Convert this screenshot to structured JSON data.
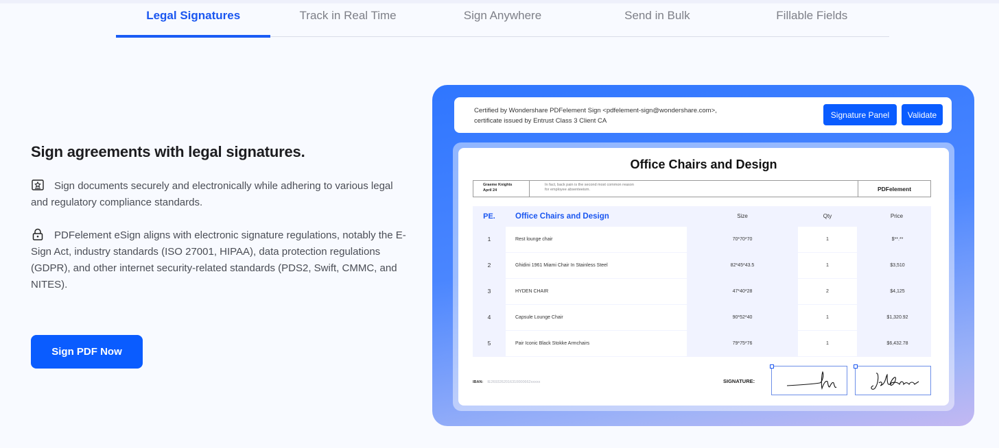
{
  "tabs": [
    {
      "label": "Legal Signatures",
      "active": true
    },
    {
      "label": "Track in Real Time",
      "active": false
    },
    {
      "label": "Sign Anywhere",
      "active": false
    },
    {
      "label": "Send in Bulk",
      "active": false
    },
    {
      "label": "Fillable Fields",
      "active": false
    }
  ],
  "content": {
    "heading": "Sign agreements with legal signatures.",
    "para1": "Sign documents securely and electronically while adhering to various legal and regulatory compliance standards.",
    "para2": "PDFelement eSign aligns with electronic signature regulations, notably the E-Sign Act, industry standards (ISO 27001, HIPAA), data protection regulations (GDPR), and other internet security-related standards (PDS2, Swift, CMMC, and NITES).",
    "para1_icon": "certificate-icon",
    "para2_icon": "lock-icon",
    "cta_label": "Sign PDF Now"
  },
  "preview": {
    "cert_line1": "Certified by Wondershare PDFelement Sign <pdfelement-sign@wondershare.com>,",
    "cert_line2": "certificate issued by Entrust Class 3 Client CA",
    "signature_panel_label": "Signature Panel",
    "validate_label": "Validate",
    "doc_title": "Office Chairs and Design",
    "info_name": "Graeme Knights",
    "info_date": "April 24",
    "info_text1": "In fact, back pain is the second most common reason",
    "info_text2": "for employee absenteeism.",
    "info_brand": "PDFelement",
    "table_headers": {
      "pe": "PE.",
      "name": "Office Chairs and Design",
      "size": "Size",
      "qty": "Qty",
      "price": "Price"
    },
    "rows": [
      {
        "no": "1",
        "name": "Rest lounge chair",
        "size": "70*70*70",
        "qty": "1",
        "price": "$**.**"
      },
      {
        "no": "2",
        "name": "Ghidini 1961 Miami Chair In Stainless Steel",
        "size": "82*45*43.5",
        "qty": "1",
        "price": "$3,510"
      },
      {
        "no": "3",
        "name": "HYDEN CHAIR",
        "size": "47*40*28",
        "qty": "2",
        "price": "$4,125"
      },
      {
        "no": "4",
        "name": "Capsule Lounge Chair",
        "size": "90*52*40",
        "qty": "1",
        "price": "$1,320.92"
      },
      {
        "no": "5",
        "name": "Pair Iconic Black Stokke Armchairs",
        "size": "79*75*76",
        "qty": "1",
        "price": "$6,432.78"
      }
    ],
    "iban_label": "IBAN:",
    "iban_value": "IE2693262016310000662xxxxx",
    "signature_label": "SIGNATURE:"
  },
  "colors": {
    "accent": "#0a5cff",
    "tab_active": "#1a56f0"
  }
}
